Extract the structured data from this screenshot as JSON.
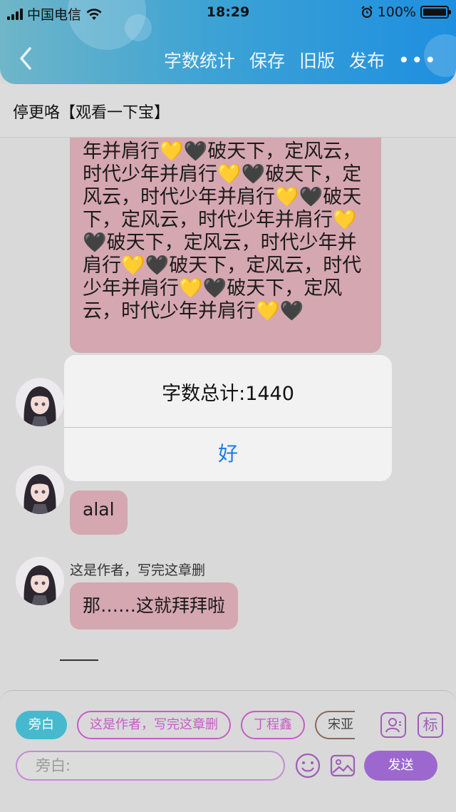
{
  "status_bar": {
    "carrier": "中国电信",
    "time": "18:29",
    "battery": "100%"
  },
  "nav": {
    "actions": [
      "字数统计",
      "保存",
      "旧版",
      "发布"
    ],
    "more": "•••"
  },
  "title": "停更咯【观看一下宝】",
  "chat": {
    "long_message": "年并肩行💛🖤破天下，定风云，时代少年并肩行💛🖤破天下，定风云，时代少年并肩行💛🖤破天下，定风云，时代少年并肩行💛🖤破天下，定风云，时代少年并肩行💛🖤破天下，定风云，时代少年并肩行💛🖤破天下，定风云，时代少年并肩行💛🖤",
    "messages": [
      {
        "name": "",
        "text": "alal"
      },
      {
        "name": "这是作者，写完这章删",
        "text": "那……这就拜拜啦"
      }
    ]
  },
  "alert": {
    "message": "字数总计:1440",
    "ok_label": "好"
  },
  "bottom": {
    "chips": [
      "旁白",
      "这是作者，写完这章删",
      "丁程鑫",
      "宋亚"
    ],
    "tag_button": "标",
    "input_placeholder": "旁白:",
    "send_label": "发送"
  },
  "colors": {
    "header_gradient_start": "#6fb6c8",
    "header_gradient_end": "#1e8fe0",
    "bubble": "#d5a7b1",
    "accent_purple": "#9c68cf",
    "chip_active": "#46b9cf",
    "alert_button": "#1a7ee6"
  }
}
